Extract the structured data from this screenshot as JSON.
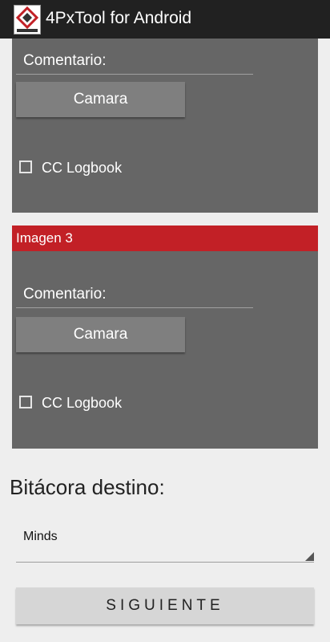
{
  "app": {
    "title": "4PxTool for Android"
  },
  "panels": [
    {
      "comment_label": "Comentario:",
      "camera_label": "Camara",
      "checkbox_label": "CC Logbook"
    },
    {
      "header": "Imagen 3",
      "comment_label": "Comentario:",
      "camera_label": "Camara",
      "checkbox_label": "CC Logbook"
    }
  ],
  "destination": {
    "label": "Bitácora destino:",
    "selected": "Minds"
  },
  "next_label": "SIGUIENTE",
  "colors": {
    "appbar": "#212121",
    "panel": "#666666",
    "header": "#c22026",
    "background": "#eeeeee"
  }
}
